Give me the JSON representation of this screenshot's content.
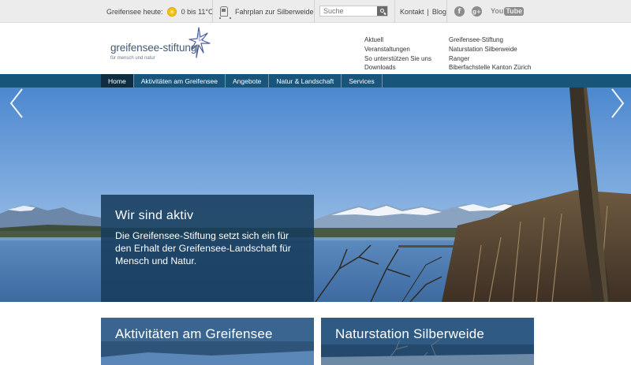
{
  "topbar": {
    "weather_label": "Greifensee heute:",
    "weather_value": "0 bis 11°C",
    "timetable_link": "Fahrplan zur Silberweide",
    "search_placeholder": "Suche",
    "contact_link": "Kontakt",
    "divider": "|",
    "blog_link": "Blog",
    "social": {
      "facebook": "f",
      "googleplus": "g+",
      "youtube_you": "You",
      "youtube_tube": "Tube"
    }
  },
  "header": {
    "logo_name": "greifensee-stiftung",
    "logo_tagline": "für mensch und natur",
    "links_left": [
      "Aktuell",
      "Veranstaltungen",
      "So unterstützen Sie uns",
      "Downloads"
    ],
    "links_right": [
      "Greifensee-Stiftung",
      "Naturstation Silberweide",
      "Ranger",
      "Biberfachstelle Kanton Zürich"
    ]
  },
  "nav": {
    "items": [
      "Home",
      "Aktivitäten am Greifensee",
      "Angebote",
      "Natur & Landschaft",
      "Services"
    ],
    "active_index": 0
  },
  "hero": {
    "title": "Wir sind aktiv",
    "text": "Die Greifensee-Stiftung setzt sich ein für den Erhalt der Greifensee-Landschaft für Mensch und Natur."
  },
  "cards": [
    {
      "title": "Aktivitäten am Greifensee"
    },
    {
      "title": "Naturstation Silberweide"
    }
  ],
  "colors": {
    "nav_bg": "#19557a",
    "nav_active": "#0f2d40",
    "overlay": "#173c5c",
    "sky": "#5f9ad8",
    "lake": "#4f7fb5"
  }
}
